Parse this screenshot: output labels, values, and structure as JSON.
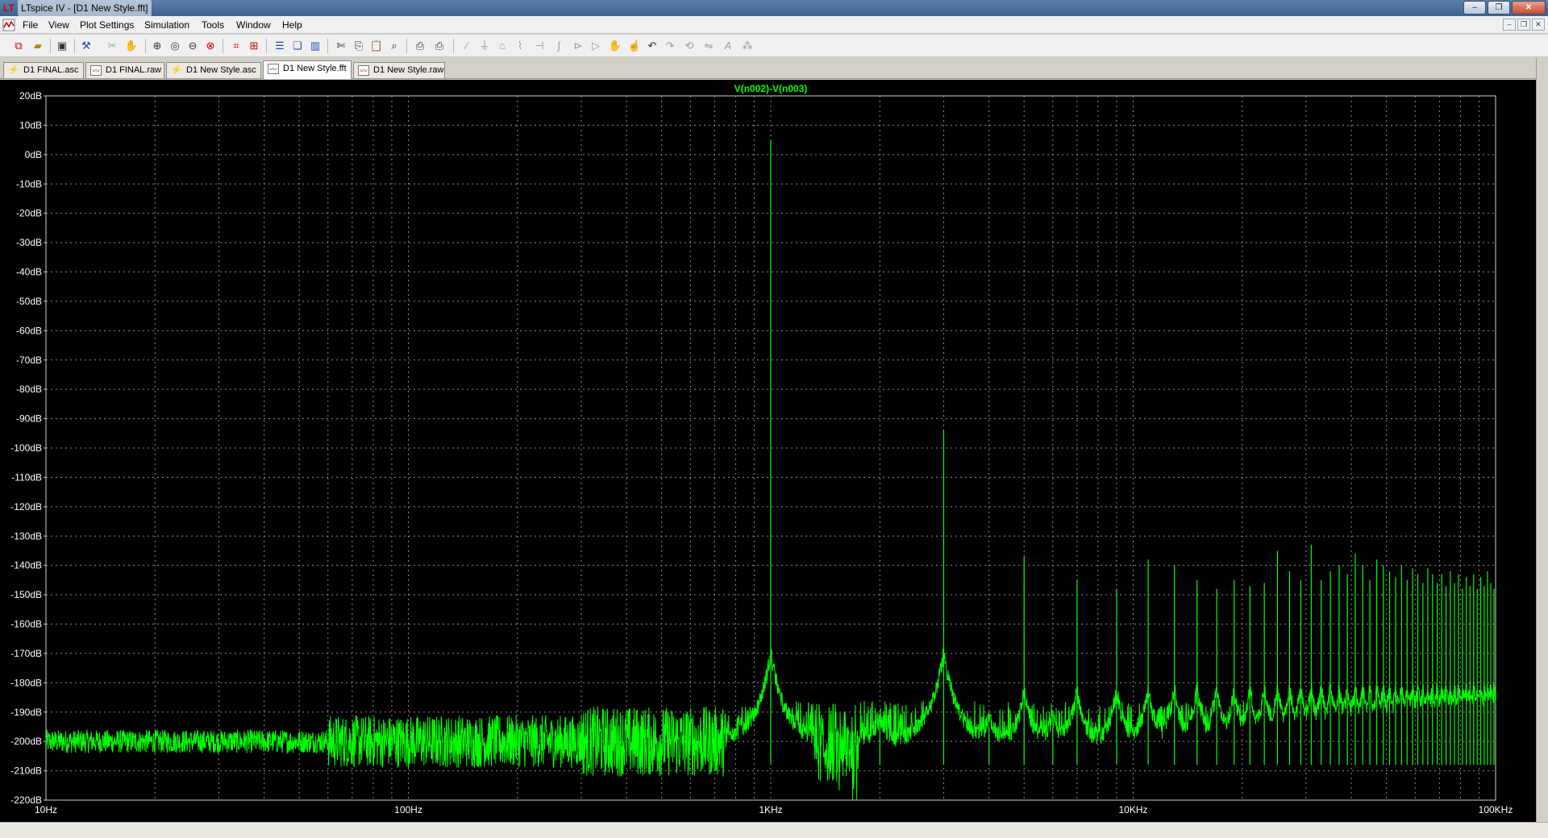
{
  "window": {
    "title": "LTspice IV - [D1 New Style.fft]",
    "controls": {
      "minimize": "–",
      "restore": "❐",
      "close": "✕"
    }
  },
  "menubar": {
    "items": [
      "File",
      "View",
      "Plot Settings",
      "Simulation",
      "Tools",
      "Window",
      "Help"
    ],
    "mdi_controls": [
      "–",
      "❐",
      "✕"
    ]
  },
  "toolbar": {
    "icons": [
      "new-schematic-icon",
      "open-icon",
      "save-icon",
      "control-panel-icon",
      "cut-dim-icon",
      "pan-icon",
      "zoom-in-icon",
      "zoom-area-icon",
      "zoom-out-icon",
      "zoom-fit-icon",
      "autorange-icon",
      "grid-icon",
      "tile-horizontal-icon",
      "cascade-icon",
      "tile-vertical-icon",
      "scissors-icon",
      "copy-icon",
      "paste-icon",
      "find-icon",
      "print-preview-icon",
      "print-icon",
      "wire-icon",
      "ground-icon",
      "label-icon",
      "resistor-icon",
      "capacitor-icon",
      "inductor-icon",
      "diode-icon",
      "component-icon",
      "move-icon",
      "drag-icon",
      "undo-icon",
      "redo-icon",
      "rotate-icon",
      "mirror-icon",
      "text-icon",
      "spice-directive-icon"
    ]
  },
  "tabs": [
    {
      "label": "D1 FINAL.asc",
      "kind": "schematic",
      "active": false
    },
    {
      "label": "D1 FINAL.raw",
      "kind": "waveform",
      "active": false
    },
    {
      "label": "D1 New Style.asc",
      "kind": "schematic",
      "active": false
    },
    {
      "label": "D1 New Style.fft",
      "kind": "waveform",
      "active": true
    },
    {
      "label": "D1 New Style.raw",
      "kind": "waveform",
      "active": false
    }
  ],
  "chart_data": {
    "type": "line",
    "title": "V(n002)-V(n003)",
    "xscale": "log",
    "xlim": [
      10,
      100000
    ],
    "ylim": [
      -220,
      20
    ],
    "xticks": [
      {
        "value": 10,
        "label": "10Hz"
      },
      {
        "value": 100,
        "label": "100Hz"
      },
      {
        "value": 1000,
        "label": "1KHz"
      },
      {
        "value": 10000,
        "label": "10KHz"
      },
      {
        "value": 100000,
        "label": "100KHz"
      }
    ],
    "yticks": [
      {
        "value": 20,
        "label": "20dB"
      },
      {
        "value": 10,
        "label": "10dB"
      },
      {
        "value": 0,
        "label": "0dB"
      },
      {
        "value": -10,
        "label": "-10dB"
      },
      {
        "value": -20,
        "label": "-20dB"
      },
      {
        "value": -30,
        "label": "-30dB"
      },
      {
        "value": -40,
        "label": "-40dB"
      },
      {
        "value": -50,
        "label": "-50dB"
      },
      {
        "value": -60,
        "label": "-60dB"
      },
      {
        "value": -70,
        "label": "-70dB"
      },
      {
        "value": -80,
        "label": "-80dB"
      },
      {
        "value": -90,
        "label": "-90dB"
      },
      {
        "value": -100,
        "label": "-100dB"
      },
      {
        "value": -110,
        "label": "-110dB"
      },
      {
        "value": -120,
        "label": "-120dB"
      },
      {
        "value": -130,
        "label": "-130dB"
      },
      {
        "value": -140,
        "label": "-140dB"
      },
      {
        "value": -150,
        "label": "-150dB"
      },
      {
        "value": -160,
        "label": "-160dB"
      },
      {
        "value": -170,
        "label": "-170dB"
      },
      {
        "value": -180,
        "label": "-180dB"
      },
      {
        "value": -190,
        "label": "-190dB"
      },
      {
        "value": -200,
        "label": "-200dB"
      },
      {
        "value": -210,
        "label": "-210dB"
      },
      {
        "value": -220,
        "label": "-220dB"
      }
    ],
    "grid": true,
    "noise_floor_db": -200,
    "series": [
      {
        "name": "V(n002)-V(n003)",
        "color": "#00ff00",
        "peaks": [
          {
            "x": 1000,
            "y": 5
          },
          {
            "x": 2000,
            "y": -193
          },
          {
            "x": 3000,
            "y": -94
          },
          {
            "x": 4000,
            "y": -195
          },
          {
            "x": 5000,
            "y": -137
          },
          {
            "x": 6000,
            "y": -195
          },
          {
            "x": 7000,
            "y": -145
          },
          {
            "x": 9000,
            "y": -148
          },
          {
            "x": 11000,
            "y": -138
          },
          {
            "x": 13000,
            "y": -140
          },
          {
            "x": 15000,
            "y": -145
          },
          {
            "x": 17000,
            "y": -148
          },
          {
            "x": 19000,
            "y": -145
          },
          {
            "x": 21000,
            "y": -147
          },
          {
            "x": 23000,
            "y": -146
          },
          {
            "x": 25000,
            "y": -135
          },
          {
            "x": 27000,
            "y": -142
          },
          {
            "x": 29000,
            "y": -145
          },
          {
            "x": 31000,
            "y": -133
          },
          {
            "x": 33000,
            "y": -145
          },
          {
            "x": 35000,
            "y": -142
          },
          {
            "x": 37000,
            "y": -140
          },
          {
            "x": 39000,
            "y": -143
          },
          {
            "x": 41000,
            "y": -136
          },
          {
            "x": 43000,
            "y": -140
          },
          {
            "x": 45000,
            "y": -145
          },
          {
            "x": 47000,
            "y": -138
          },
          {
            "x": 49000,
            "y": -140
          },
          {
            "x": 51000,
            "y": -142
          },
          {
            "x": 53000,
            "y": -144
          },
          {
            "x": 55000,
            "y": -140
          },
          {
            "x": 57000,
            "y": -145
          },
          {
            "x": 59000,
            "y": -141
          },
          {
            "x": 61000,
            "y": -143
          },
          {
            "x": 63000,
            "y": -146
          },
          {
            "x": 65000,
            "y": -141
          },
          {
            "x": 67000,
            "y": -143
          },
          {
            "x": 69000,
            "y": -146
          },
          {
            "x": 71000,
            "y": -143
          },
          {
            "x": 73000,
            "y": -147
          },
          {
            "x": 75000,
            "y": -142
          },
          {
            "x": 77000,
            "y": -146
          },
          {
            "x": 79000,
            "y": -143
          },
          {
            "x": 81000,
            "y": -148
          },
          {
            "x": 83000,
            "y": -144
          },
          {
            "x": 85000,
            "y": -147
          },
          {
            "x": 87000,
            "y": -143
          },
          {
            "x": 89000,
            "y": -148
          },
          {
            "x": 91000,
            "y": -144
          },
          {
            "x": 93000,
            "y": -147
          },
          {
            "x": 95000,
            "y": -142
          },
          {
            "x": 97000,
            "y": -146
          },
          {
            "x": 99000,
            "y": -148
          }
        ]
      }
    ]
  }
}
